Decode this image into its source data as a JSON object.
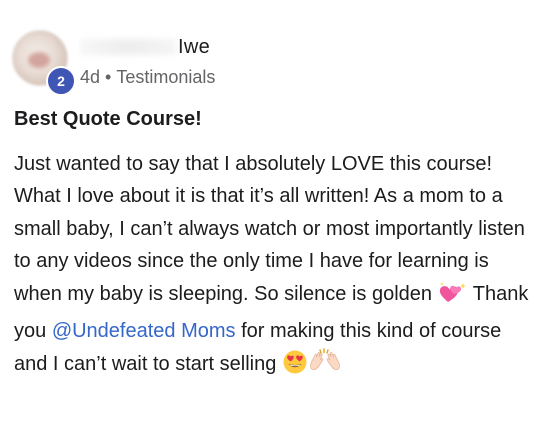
{
  "post": {
    "author_name": "Iwe",
    "author_level": "2",
    "age": "4d",
    "separator": "•",
    "category": "Testimonials",
    "title": "Best Quote Course!",
    "body": {
      "part1": "Just wanted to say that I absolutely LOVE this course! What I love about it is that it’s all written! As a mom to a small baby, I can’t always watch or most importantly listen to any videos since the only time I have for learning is when my baby is sleeping. So silence is golden ",
      "part2": " Thank you ",
      "mention": "@Undefeated Moms",
      "part3": " for making this kind of course and I can’t wait to start selling "
    },
    "icons": {
      "heart": "sparkling-heart-icon",
      "heart_eyes": "heart-eyes-face-icon",
      "raised_hands": "raised-hands-icon"
    },
    "colors": {
      "level_badge": "#3f56b5",
      "mention": "#3566c9",
      "meta_text": "#646466"
    }
  }
}
